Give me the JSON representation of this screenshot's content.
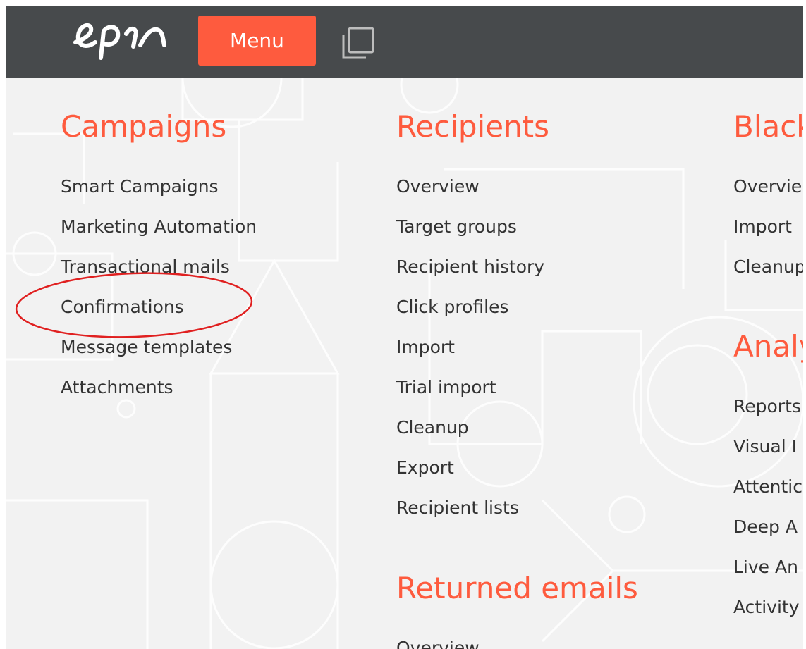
{
  "topbar": {
    "menu_label": "Menu",
    "logo_icon": "epi-logo-icon",
    "windows_icon": "windows-stack-icon",
    "background": "#474a4c",
    "accent": "#fe5b3e"
  },
  "campaigns": {
    "title": "Campaigns",
    "items": [
      "Smart Campaigns",
      "Marketing Automation",
      "Transactional mails",
      "Confirmations",
      "Message templates",
      "Attachments"
    ]
  },
  "recipients": {
    "title": "Recipients",
    "items": [
      "Overview",
      "Target groups",
      "Recipient history",
      "Click profiles",
      "Import",
      "Trial import",
      "Cleanup",
      "Export",
      "Recipient lists"
    ]
  },
  "returned_emails": {
    "title": "Returned emails",
    "items": [
      "Overview"
    ]
  },
  "blacklist": {
    "title": "Black",
    "items": [
      "Overvie",
      "Import",
      "Cleanup"
    ]
  },
  "analytics": {
    "title": "Analy",
    "items": [
      "Reports",
      "Visual I",
      "Attentic",
      "Deep A",
      "Live An",
      "Activity"
    ]
  },
  "annotation": {
    "highlight_color": "#e02020"
  }
}
